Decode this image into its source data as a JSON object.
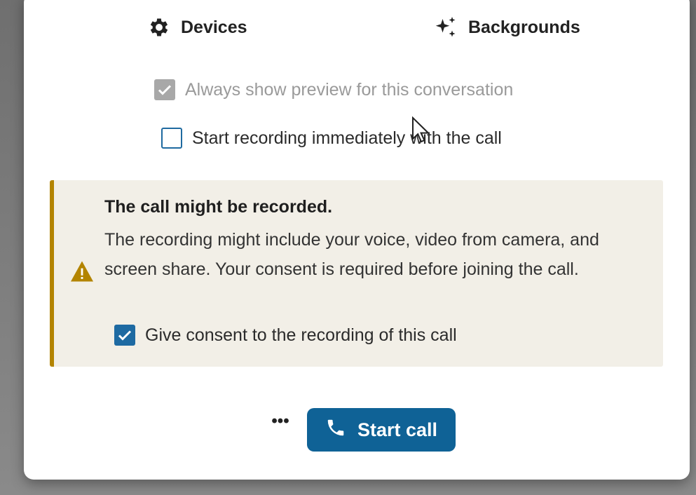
{
  "tabs": {
    "devices_label": "Devices",
    "backgrounds_label": "Backgrounds"
  },
  "options": {
    "always_preview_label": "Always show preview for this conversation",
    "always_preview_checked": true,
    "always_preview_disabled": true,
    "start_recording_label": "Start recording immediately with the call",
    "start_recording_checked": false
  },
  "recording_notice": {
    "title": "The call might be recorded.",
    "body": "The recording might include your voice, video from camera, and screen share. Your consent is required before joining the call.",
    "consent_label": "Give consent to the recording of this call",
    "consent_checked": true
  },
  "footer": {
    "more_label": "•••",
    "start_call_label": "Start call"
  },
  "icons": {
    "devices": "gear-icon",
    "backgrounds": "sparkles-icon",
    "warning": "warning-triangle-icon",
    "start_call": "phone-icon"
  },
  "colors": {
    "primary": "#0f6296",
    "checkbox_blue": "#1e6aa2",
    "warning_accent": "#b38400",
    "warning_bg": "#f2efe7",
    "disabled_text": "#9a9a9a"
  }
}
